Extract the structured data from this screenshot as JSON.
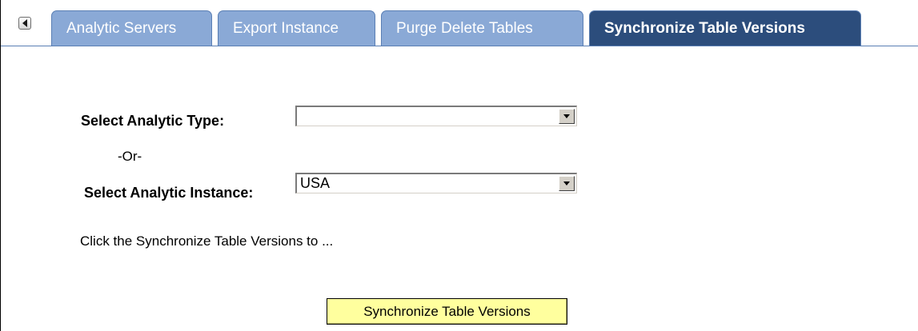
{
  "tabs": [
    {
      "label": "Analytic Servers",
      "active": false
    },
    {
      "label": "Export Instance",
      "active": false
    },
    {
      "label": "Purge Delete Tables",
      "active": false
    },
    {
      "label": "Synchronize Table Versions",
      "active": true
    }
  ],
  "form": {
    "analytic_type_label": "Select Analytic Type:",
    "analytic_type_value": "",
    "or_label": "-Or-",
    "analytic_instance_label": "Select Analytic Instance:",
    "analytic_instance_value": "USA",
    "hint_text": "Click the Synchronize Table Versions to ...",
    "sync_button_label": "Synchronize Table Versions"
  },
  "colors": {
    "tab_inactive": "#8aa9d6",
    "tab_active": "#2c4d7c",
    "tab_border": "#5a7fb4",
    "button_bg": "#ffff9e"
  },
  "icons": {
    "scroll_left": "scroll-left-icon",
    "dropdown": "chevron-down-icon"
  }
}
